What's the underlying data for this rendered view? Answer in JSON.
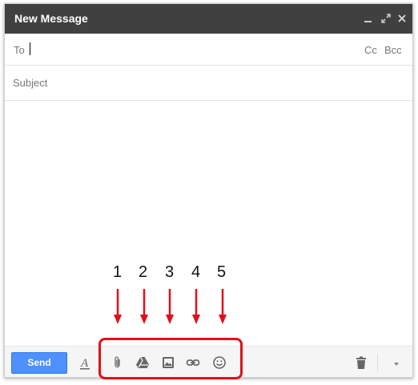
{
  "window": {
    "title": "New Message",
    "controls": {
      "minimize_icon": "minimize-icon",
      "expand_icon": "expand-icon",
      "close_icon": "close-icon"
    }
  },
  "to_row": {
    "label": "To",
    "value": "",
    "cc_label": "Cc",
    "bcc_label": "Bcc"
  },
  "subject": {
    "placeholder": "Subject",
    "value": ""
  },
  "body": {
    "value": ""
  },
  "toolbar": {
    "send_label": "Send",
    "icons": [
      "formatting-icon",
      "attach-icon",
      "drive-icon",
      "photo-icon",
      "link-icon",
      "emoji-icon",
      "trash-icon",
      "more-options-icon"
    ],
    "send_color": "#4d90fe"
  },
  "annotations": {
    "numbers": [
      "1",
      "2",
      "3",
      "4",
      "5"
    ],
    "color": "#e0101a"
  },
  "colors": {
    "titlebar": "#404040",
    "toolbar_bg": "#f5f5f5"
  }
}
